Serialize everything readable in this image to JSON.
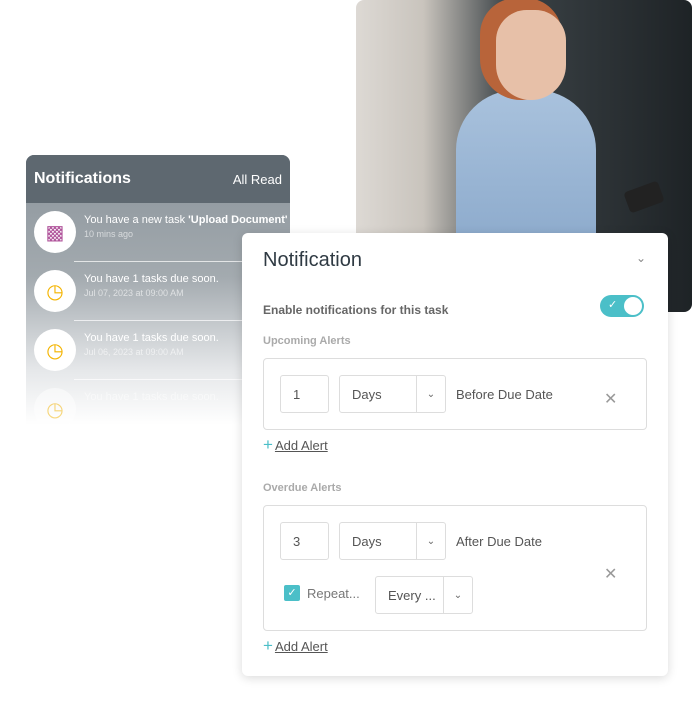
{
  "notifications_panel": {
    "title": "Notifications",
    "all_read": "All Read",
    "items": [
      {
        "icon": "task-document-icon",
        "prefix": "You have a new task ",
        "bold": "'Upload Document'",
        "time": "10 mins ago"
      },
      {
        "icon": "clock-due-icon",
        "message": "You have 1 tasks due soon.",
        "time": "Jul 07, 2023 at 09:00 AM"
      },
      {
        "icon": "clock-due-icon",
        "message": "You have 1 tasks due soon.",
        "time": "Jul 06, 2023 at 09:00 AM"
      },
      {
        "icon": "clock-due-icon",
        "message": "You have 1 tasks due soon.",
        "time": ""
      }
    ]
  },
  "card": {
    "title": "Notification",
    "enable_label": "Enable notifications for this task",
    "enabled": true,
    "upcoming": {
      "label": "Upcoming Alerts",
      "value": "1",
      "unit": "Days",
      "relation": "Before Due Date",
      "add": "Add Alert"
    },
    "overdue": {
      "label": "Overdue Alerts",
      "value": "3",
      "unit": "Days",
      "relation": "After Due Date",
      "repeat_label": "Repeat...",
      "repeat_checked": true,
      "repeat_value": "Every ...",
      "add": "Add Alert"
    }
  },
  "colors": {
    "accent": "#4bbfc8",
    "header": "#5e6870",
    "task_icon": "#b0549b",
    "clock_icon": "#f4b400"
  }
}
